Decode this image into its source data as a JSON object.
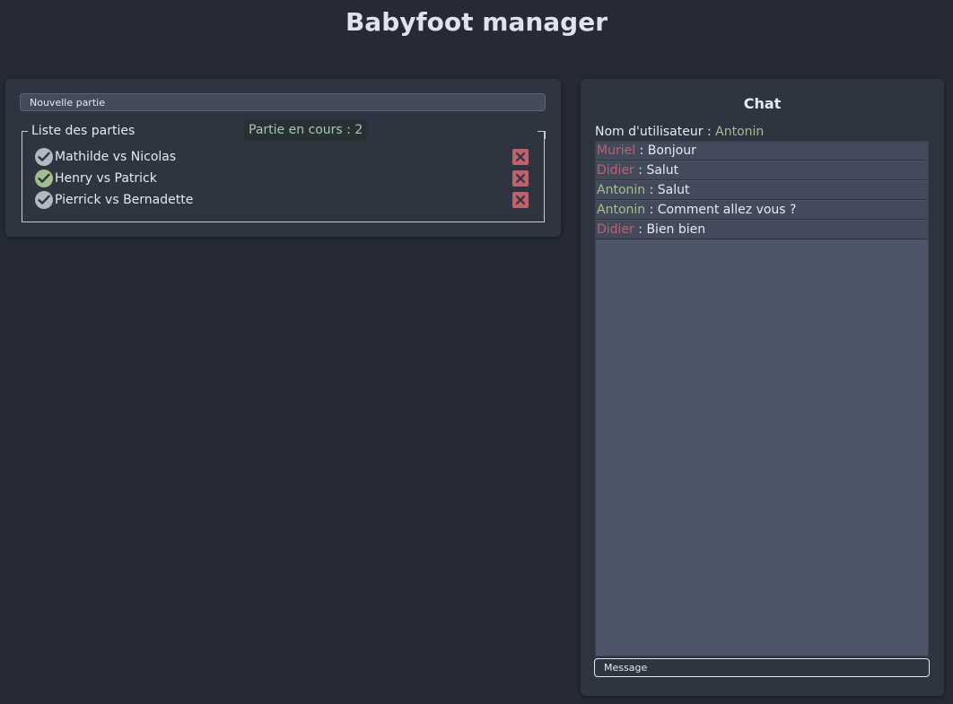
{
  "header": {
    "title": "Babyfoot manager"
  },
  "games": {
    "new_game_placeholder": "Nouvelle partie",
    "list_legend": "Liste des parties",
    "ongoing_label": "Partie en cours : 2",
    "items": [
      {
        "label": "Mathilde vs Nicolas",
        "status": "finished",
        "check_icon": "check-circle-icon",
        "delete_icon": "close-icon"
      },
      {
        "label": "Henry vs Patrick",
        "status": "ongoing",
        "check_icon": "check-circle-icon",
        "delete_icon": "close-icon"
      },
      {
        "label": "Pierrick vs Bernadette",
        "status": "finished",
        "check_icon": "check-circle-icon",
        "delete_icon": "close-icon"
      }
    ]
  },
  "chat": {
    "title": "Chat",
    "username_label": "Nom d'utilisateur : ",
    "username": "Antonin",
    "messages": [
      {
        "author": "Muriel",
        "separator": " : ",
        "text": "Bonjour",
        "author_color": "red"
      },
      {
        "author": "Didier",
        "separator": " : ",
        "text": "Salut",
        "author_color": "red"
      },
      {
        "author": "Antonin",
        "separator": " : ",
        "text": "Salut",
        "author_color": "green"
      },
      {
        "author": "Antonin",
        "separator": " : ",
        "text": "Comment allez vous ?",
        "author_color": "green"
      },
      {
        "author": "Didier",
        "separator": " : ",
        "text": "Bien bien",
        "author_color": "red"
      }
    ],
    "message_placeholder": "Message"
  },
  "colors": {
    "background": "#252a35",
    "panel": "#2f3441",
    "accent_green": "#a3be8c",
    "accent_red": "#bf616a",
    "chat_area": "#4d5569"
  }
}
